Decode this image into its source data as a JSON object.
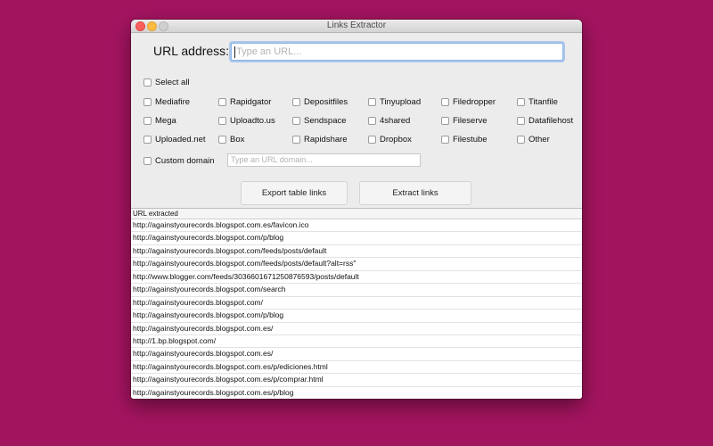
{
  "window": {
    "title": "Links Extractor"
  },
  "url": {
    "label": "URL address:",
    "placeholder": "Type an URL..."
  },
  "select_all": "Select all",
  "services": [
    [
      "Mediafire",
      "Rapidgator",
      "Depositfiles",
      "Tinyupload",
      "Filedropper",
      "Titanfile"
    ],
    [
      "Mega",
      "Uploadto.us",
      "Sendspace",
      "4shared",
      "Fileserve",
      "Datafilehost"
    ],
    [
      "Uploaded.net",
      "Box",
      "Rapidshare",
      "Dropbox",
      "Filestube",
      "Other"
    ]
  ],
  "custom_domain": {
    "label": "Custom domain",
    "placeholder": "Type an URL domain..."
  },
  "buttons": {
    "export": "Export table links",
    "extract": "Extract links"
  },
  "table": {
    "header": "URL extracted",
    "rows": [
      "http://againstyourecords.blogspot.com.es/favicon.ico",
      "http://againstyourecords.blogspot.com/p/blog",
      "http://againstyourecords.blogspot.com/feeds/posts/default",
      "http://againstyourecords.blogspot.com/feeds/posts/default?alt=rss\"",
      "http://www.blogger.com/feeds/3036601671250876593/posts/default",
      "http://againstyourecords.blogspot.com/search",
      "http://againstyourecords.blogspot.com/",
      "http://againstyourecords.blogspot.com/p/blog",
      "http://againstyourecords.blogspot.com.es/",
      "http://1.bp.blogspot.com/",
      "http://againstyourecords.blogspot.com.es/",
      "http://againstyourecords.blogspot.com.es/p/ediciones.html",
      "http://againstyourecords.blogspot.com.es/p/comprar.html",
      "http://againstyourecords.blogspot.com.es/p/blog"
    ]
  }
}
